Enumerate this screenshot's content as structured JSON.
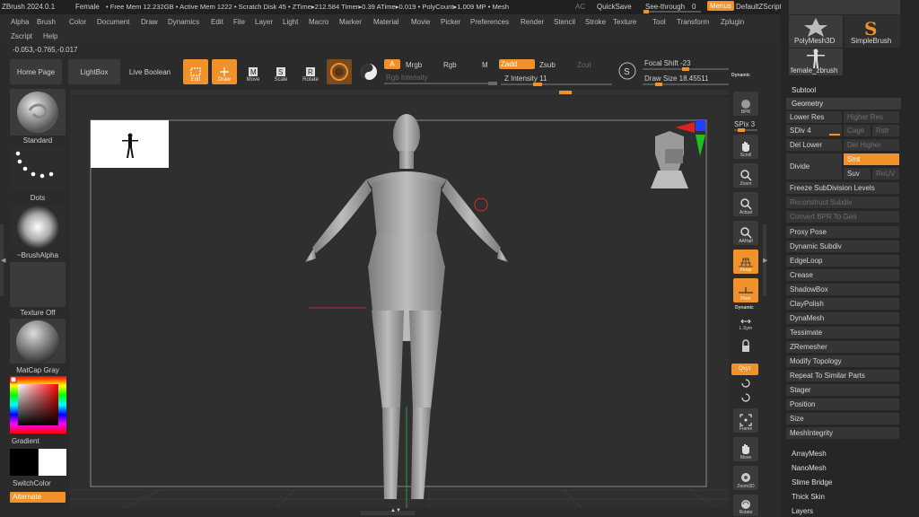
{
  "titlebar": {
    "app": "ZBrush 2024.0.1",
    "doc": "Female",
    "stats": "• Free Mem 12.232GB • Active Mem 1222 • Scratch Disk 45 • ZTime▸212.584 Timer▸0.39 ATime▸0.019 • PolyCount▸1.009 MP • Mesh",
    "ac": "AC",
    "quicksave": "QuickSave",
    "seethrough": "See-through",
    "seethrough_value": "0",
    "menus": "Menus",
    "script": "DefaultZScript"
  },
  "menu": {
    "row1": [
      "Alpha",
      "Brush",
      "Color",
      "Document",
      "Draw",
      "Dynamics",
      "Edit",
      "File",
      "Layer",
      "Light",
      "Macro",
      "Marker",
      "Material",
      "Movie",
      "Picker",
      "Preferences",
      "Render",
      "Stencil",
      "Stroke",
      "Texture",
      "Tool",
      "Transform",
      "Zplugin"
    ],
    "row2": [
      "Zscript",
      "Help"
    ]
  },
  "coords": "-0.053,-0.765,-0.017",
  "toolbar": {
    "home": "Home Page",
    "lightbox": "LightBox",
    "liveboolean": "Live Boolean",
    "edit": "Edit",
    "draw": "Draw",
    "move": "Move",
    "scale": "Scale",
    "rotate": "Rotate",
    "a": "A",
    "mrgb": "Mrgb",
    "rgb": "Rgb",
    "m": "M",
    "zadd": "Zadd",
    "zsub": "Zsub",
    "zcut": "Zcut",
    "rgb_intensity": "Rgb Intensity",
    "z_intensity": "Z Intensity 11",
    "focal_shift": "Focal Shift -23",
    "draw_size": "Draw Size 18.45511",
    "dynamic": "Dynamic"
  },
  "left": {
    "standard": "Standard",
    "dots": "Dots",
    "brushalpha": "~BrushAlpha",
    "texture_off": "Texture Off",
    "matcap": "MatCap Gray",
    "gradient": "Gradient",
    "switchcolor": "SwitchColor",
    "alternate": "Alternate"
  },
  "right": {
    "bpr": "BPR",
    "spix": "SPix 3",
    "scroll": "Scroll",
    "zoom": "Zoom",
    "actual": "Actual",
    "aahalf": "AAHalf",
    "persp": "Persp",
    "floor": "Floor",
    "dynamic": "Dynamic",
    "lsym": "L.Sym",
    "xyz": "Qxyz",
    "frame": "Frame",
    "move": "Move",
    "zoom3d": "Zoom3D",
    "rotate": "Rotate"
  },
  "palette": {
    "polymesh": "PolyMesh3D",
    "simplebrush": "SimpleBrush",
    "female": "female_zbrush",
    "subtool": "Subtool",
    "geometry": "Geometry",
    "lower_res": "Lower Res",
    "higher_res": "Higher Res",
    "sdiv": "SDiv 4",
    "cage": "Cage",
    "rstr": "Rstr",
    "del_lower": "Del Lower",
    "del_higher": "Del Higher",
    "divide": "Divide",
    "smt": "Smt",
    "suv": "Suv",
    "reuv": "ReUV",
    "items": [
      "Freeze SubDivision Levels",
      "Reconstruct Subdiv",
      "Convert BPR To Geo",
      "Proxy Pose",
      "Dynamic Subdiv",
      "EdgeLoop",
      "Crease",
      "ShadowBox",
      "ClayPolish",
      "DynaMesh",
      "Tessimate",
      "ZRemesher",
      "Modify Topology",
      "Repeat To Similar Parts",
      "Stager",
      "Position",
      "Size",
      "MeshIntegrity"
    ],
    "dim_items": [
      false,
      true,
      true,
      false,
      false,
      false,
      false,
      false,
      false,
      false,
      false,
      false,
      false,
      false,
      false,
      false,
      false,
      false
    ],
    "subs": [
      "ArrayMesh",
      "NanoMesh",
      "Slime Bridge",
      "Thick Skin",
      "Layers"
    ]
  },
  "colors": {
    "accent": "#f0912a",
    "panel": "#3b3b3b",
    "bg": "#2b2b2b"
  }
}
